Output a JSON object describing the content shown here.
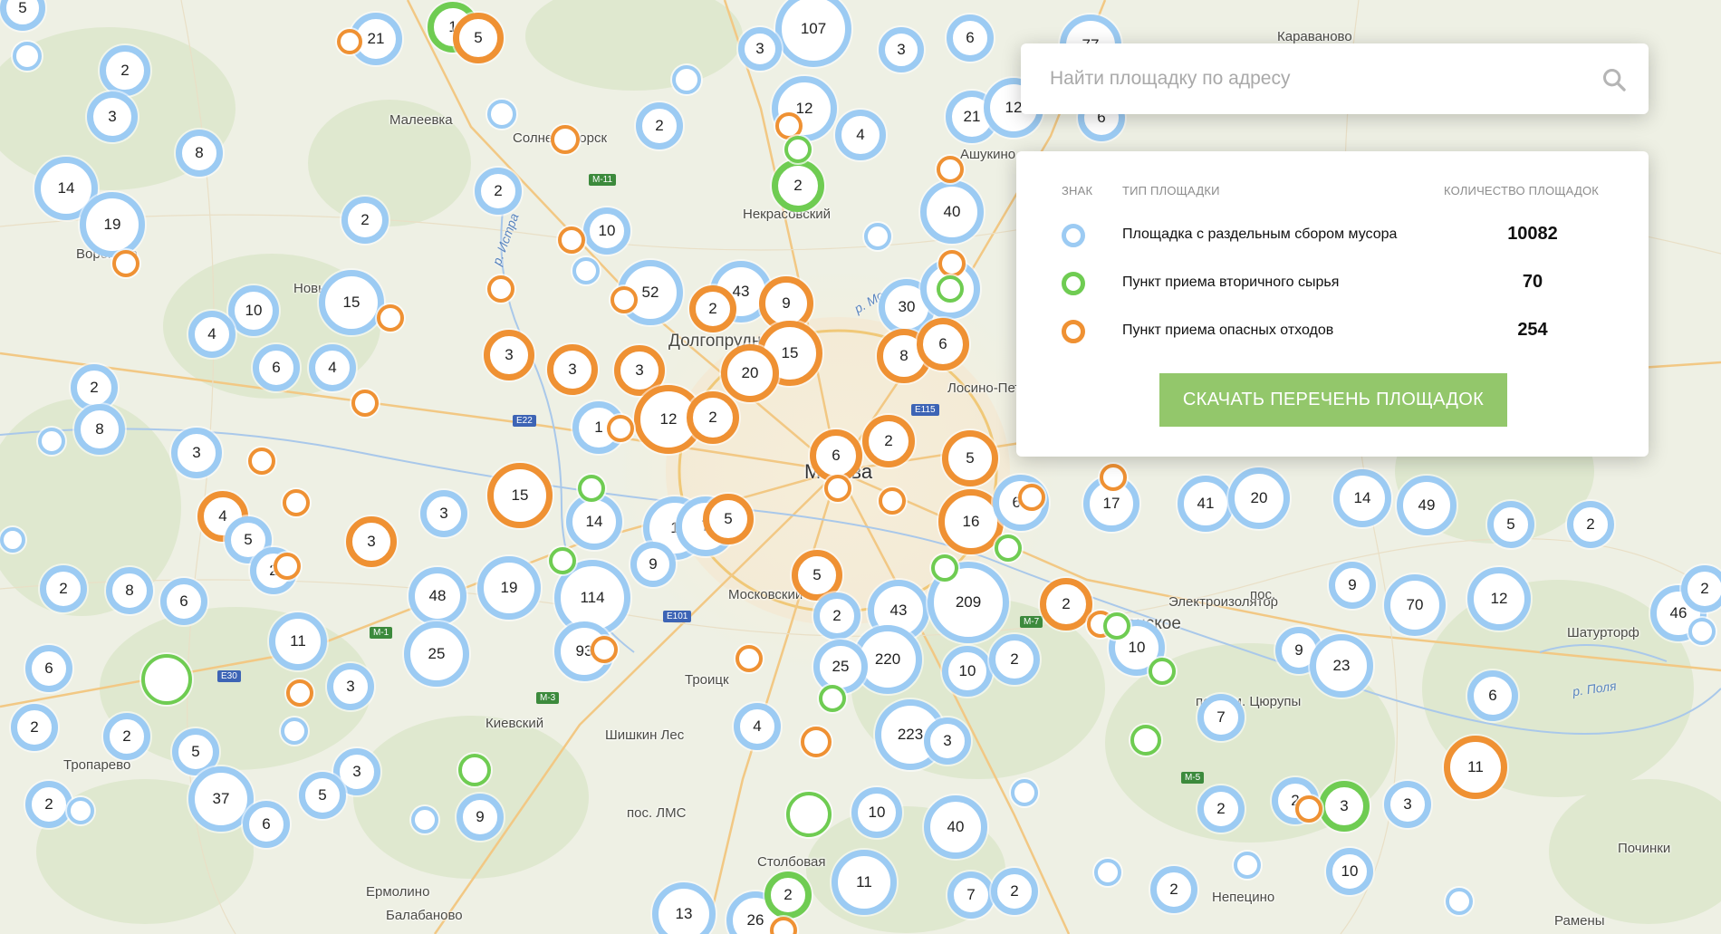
{
  "search": {
    "placeholder": "Найти площадку по адресу"
  },
  "legend": {
    "headers": {
      "sign": "ЗНАК",
      "type": "ТИП ПЛОЩАДКИ",
      "count": "КОЛИЧЕСТВО ПЛОЩАДОК"
    },
    "rows": [
      {
        "type": "Площадка с раздельным сбором мусора",
        "count": "10082",
        "color": "#9ccbf3"
      },
      {
        "type": "Пункт приема вторичного сырья",
        "count": "70",
        "color": "#6fcc52"
      },
      {
        "type": "Пункт приема опасных отходов",
        "count": "254",
        "color": "#ef9133"
      }
    ],
    "download_label": "СКАЧАТЬ ПЕРЕЧЕНЬ ПЛОЩАДОК"
  },
  "map": {
    "places": [
      "Малеевка",
      "Некрасовский",
      "Долгопрудный",
      "Москва",
      "Лосино-Петровский",
      "Электроизолятор",
      "Раменское",
      "Московский",
      "Троицк",
      "Киевский",
      "Шишкин Лес",
      "Тропарево",
      "пос. ЛМС",
      "Столбовая",
      "Ермолино",
      "Балабаново",
      "Непецино",
      "Починки",
      "Рамены",
      "Шатурторф",
      "пос. им. Цюрупы",
      "Караваново",
      "Ашукино",
      "Солнечногорск",
      "Вороново",
      "Новый",
      "пос."
    ],
    "rivers": [
      "р. Истра",
      "р. Поля",
      "р. Москва"
    ],
    "highways": [
      "M-11",
      "M-1",
      "M-3",
      "M-5",
      "E22",
      "E30",
      "E101",
      "E115",
      "M-7"
    ],
    "clusters": [
      "5",
      "21",
      "1",
      "5",
      "107",
      "3",
      "3",
      "6",
      "77",
      "2",
      "3",
      "12",
      "4",
      "2",
      "8",
      "14",
      "19",
      "2",
      "2",
      "10",
      "21",
      "12",
      "6",
      "2",
      "40",
      "52",
      "43",
      "2",
      "9",
      "30",
      "9",
      "15",
      "10",
      "4",
      "6",
      "4",
      "2",
      "3",
      "3",
      "3",
      "15",
      "20",
      "8",
      "6",
      "2",
      "8",
      "1",
      "12",
      "2",
      "3",
      "6",
      "2",
      "5",
      "15",
      "14",
      "1",
      "7",
      "5",
      "16",
      "60",
      "17",
      "41",
      "20",
      "14",
      "49",
      "5",
      "2",
      "3",
      "4",
      "5",
      "2",
      "3",
      "2",
      "8",
      "6",
      "11",
      "48",
      "19",
      "114",
      "9",
      "5",
      "2",
      "43",
      "209",
      "2",
      "9",
      "70",
      "12",
      "46",
      "2",
      "6",
      "25",
      "93",
      "220",
      "25",
      "10",
      "2",
      "10",
      "9",
      "23",
      "6",
      "2",
      "2",
      "5",
      "3",
      "3",
      "4",
      "223",
      "3",
      "7",
      "11",
      "37",
      "5",
      "3",
      "6",
      "9",
      "2",
      "10",
      "40",
      "2",
      "3",
      "2",
      "10",
      "13",
      "26",
      "2",
      "11",
      "7",
      "2",
      "2",
      "3"
    ]
  }
}
